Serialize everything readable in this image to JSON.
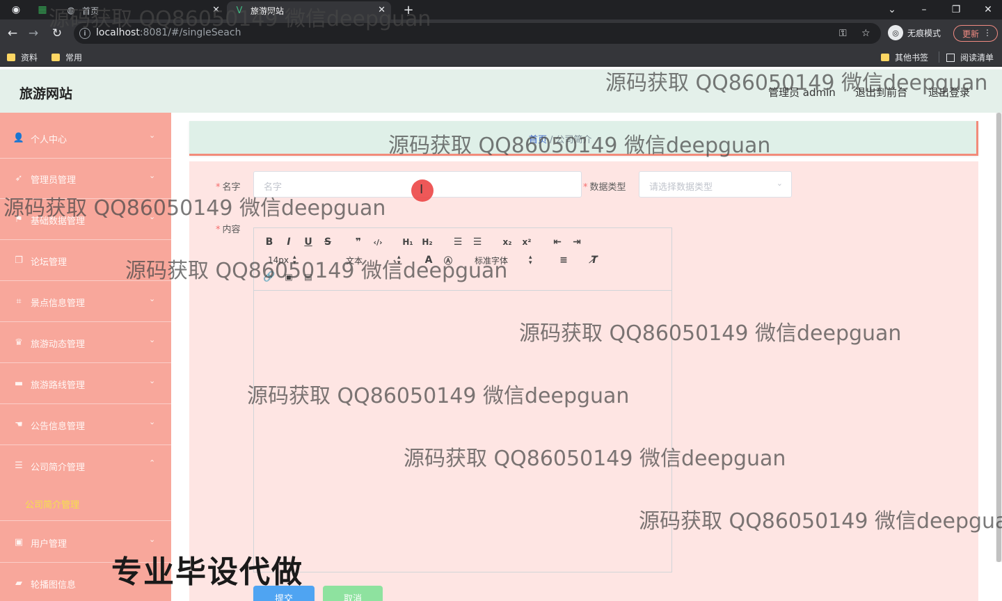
{
  "browser": {
    "tabs": [
      {
        "title": "首页"
      },
      {
        "title": "旅游网站"
      }
    ],
    "url_host": "localhost",
    "url_path": ":8081/#/singleSeach",
    "incognito_label": "无痕模式",
    "update_label": "更新",
    "bookmarks": [
      "资料",
      "常用"
    ],
    "bookmarks_right": [
      "其他书签",
      "阅读清单"
    ]
  },
  "header": {
    "site_title": "旅游网站",
    "user_label": "管理员 admin",
    "back_to_front": "退出到前台",
    "logout": "退出登录"
  },
  "sidebar": {
    "items": [
      {
        "label": "个人中心",
        "icon": "user-icon"
      },
      {
        "label": "管理员管理",
        "icon": "send-icon"
      },
      {
        "label": "基础数据管理",
        "icon": "flag-icon"
      },
      {
        "label": "论坛管理",
        "icon": "copy-icon"
      },
      {
        "label": "景点信息管理",
        "icon": "crop-icon"
      },
      {
        "label": "旅游动态管理",
        "icon": "medal-icon"
      },
      {
        "label": "旅游路线管理",
        "icon": "monitor-icon"
      },
      {
        "label": "公告信息管理",
        "icon": "hand-icon"
      },
      {
        "label": "公司简介管理",
        "icon": "menu-icon"
      },
      {
        "label": "用户管理",
        "icon": "user-group-icon"
      },
      {
        "label": "轮播图信息",
        "icon": "ticket-icon"
      }
    ],
    "submenu_label": "公司简介管理"
  },
  "breadcrumb": {
    "home": "首页",
    "current": "公司简介"
  },
  "form": {
    "name_label": "名字",
    "name_placeholder": "名字",
    "type_label": "数据类型",
    "type_placeholder": "请选择数据类型",
    "content_label": "内容",
    "font_size": "14px",
    "text_style": "文本",
    "font_family": "标准字体",
    "submit_label": "提交",
    "cancel_label": "取消"
  },
  "overlay": {
    "watermark": "源码获取 QQ86050149 微信deepguan",
    "banner": "专业毕设代做"
  },
  "colors": {
    "sidebar_bg": "#f8a79b",
    "header_bg": "#e4f0ea",
    "form_bg": "#fee5e3",
    "submit_btn": "#4fa4f2",
    "cancel_btn": "#8ee29f",
    "active_submenu": "#f5e04a"
  }
}
